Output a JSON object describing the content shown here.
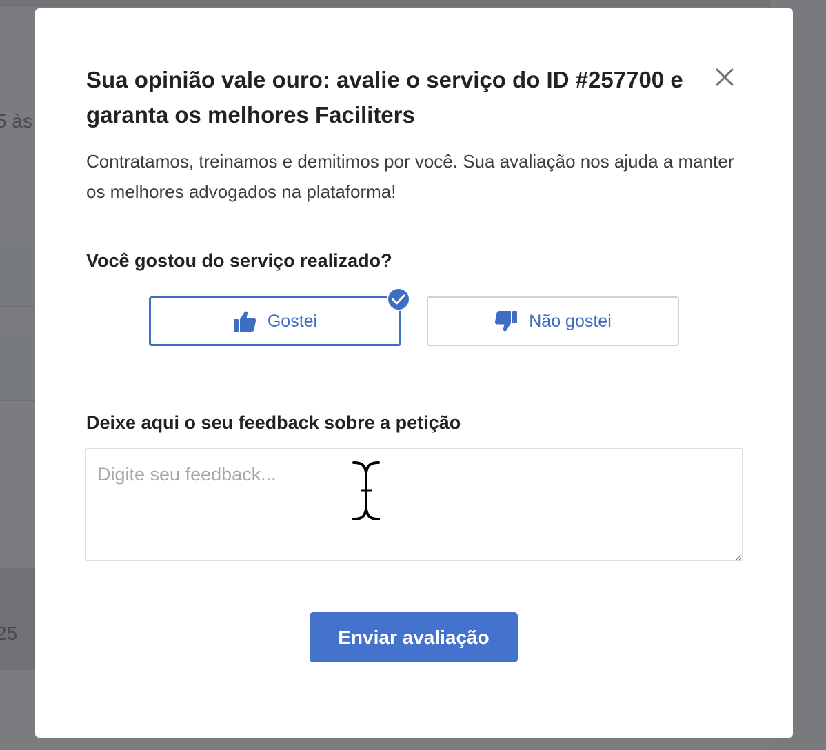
{
  "background": {
    "fragment_1": "5 às",
    "fragment_2": "25"
  },
  "modal": {
    "title": "Sua opinião vale ouro: avalie o serviço do ID #257700 e garanta os melhores Faciliters",
    "subtitle": "Contratamos, treinamos e demitimos por você. Sua avaliação nos ajuda a manter os melhores advogados na plataforma!",
    "question": "Você gostou do serviço realizado?",
    "like_label": "Gostei",
    "dislike_label": "Não gostei",
    "selected": "Gostei",
    "feedback_label": "Deixe aqui o seu feedback sobre a petição",
    "feedback_placeholder": "Digite seu feedback...",
    "feedback_value": "",
    "submit_label": "Enviar avaliação"
  },
  "icons": {
    "close": "close-icon",
    "like": "thumbs-up-icon",
    "dislike": "thumbs-down-icon",
    "selected_badge": "check-circle-icon",
    "cursor": "text-cursor-icon"
  },
  "colors": {
    "accent": "#3e6dc4",
    "button": "#4472cc",
    "overlay": "#7b7c7f",
    "text": "#212224"
  }
}
